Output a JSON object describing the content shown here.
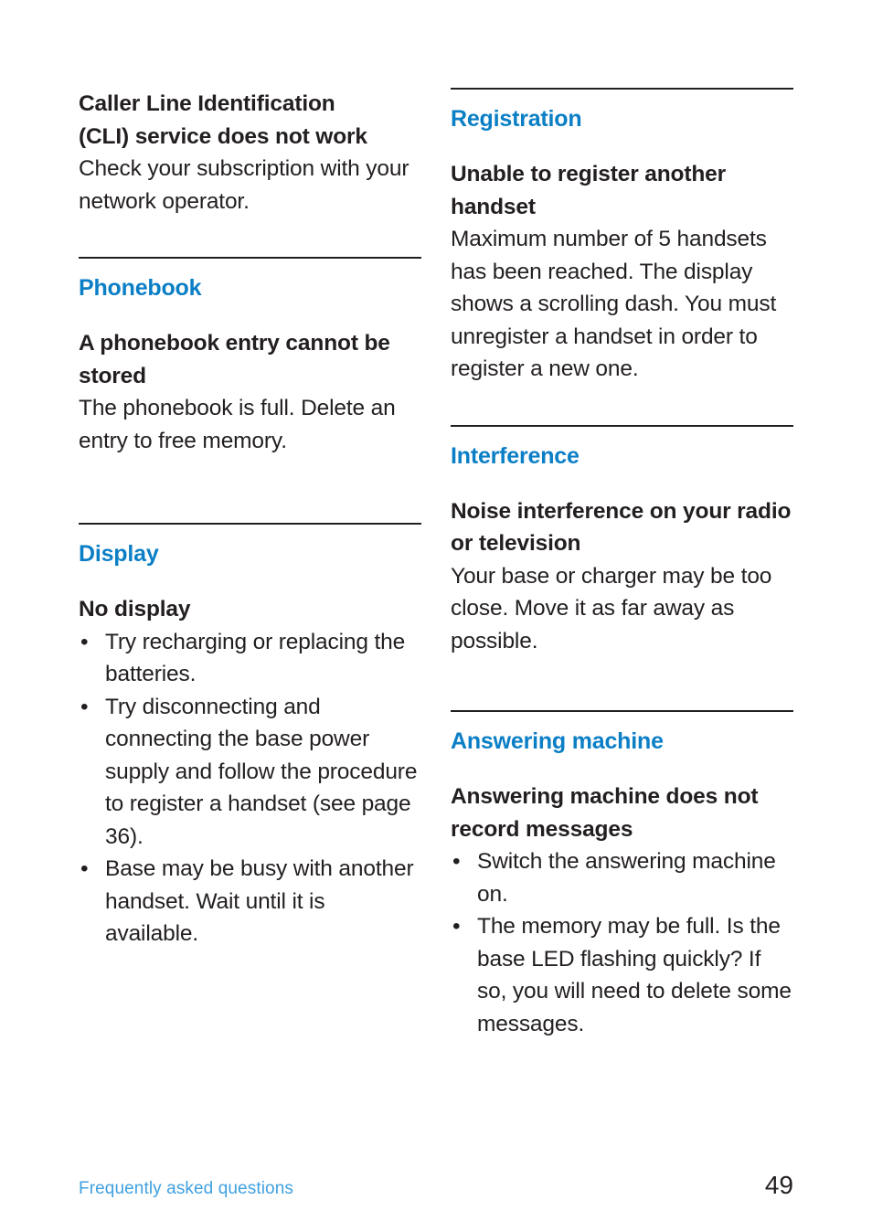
{
  "document": {
    "page_number": "49",
    "footer_label": "Frequently asked questions",
    "accent_color": "#0b7fc6",
    "footer_link_color": "#3fa0e0",
    "body_color": "#231f20"
  },
  "left_column": {
    "faq_cli": {
      "heading_line1": "Caller Line Identification",
      "heading_line2": "(CLI) service does not work",
      "body": "Check your subscription with your network operator."
    },
    "phonebook": {
      "section_title": "Phonebook",
      "faq_entry_not_stored": {
        "heading": "A phonebook entry cannot be stored",
        "body": "The phonebook is full. Delete an entry to free memory."
      }
    },
    "display": {
      "section_title": "Display",
      "faq_no_display": {
        "heading": "No display",
        "bullets": [
          "Try recharging or replacing the batteries.",
          "Try disconnecting and connecting the base power supply and follow the procedure to register a handset (see page 36).",
          "Base may be busy with another handset. Wait until it is available."
        ]
      }
    }
  },
  "right_column": {
    "registration": {
      "section_title": "Registration",
      "faq_unable_to_register": {
        "heading": "Unable to register another handset",
        "body": "Maximum number of 5 handsets has been reached. The display shows a scrolling dash. You must unregister a handset in order to register a new one."
      }
    },
    "interference": {
      "section_title": "Interference",
      "faq_noise_interference": {
        "heading": "Noise interference on your radio or television",
        "body": "Your base or charger may be too close. Move it as far away as possible."
      }
    },
    "answering_machine": {
      "section_title": "Answering machine",
      "faq_no_record": {
        "heading": "Answering machine does not record messages",
        "bullets": [
          "Switch the answering machine on.",
          "The memory may be full. Is the base LED flashing quickly? If so, you will need to delete some messages."
        ]
      }
    }
  },
  "bullet_glyph": "•"
}
